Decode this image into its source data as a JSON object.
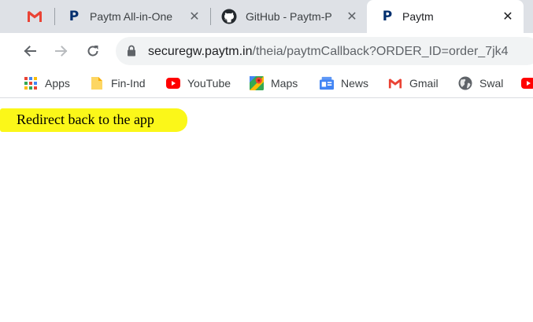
{
  "tabs": [
    {
      "title": "",
      "icon": "gmail-icon",
      "active": false
    },
    {
      "title": "Paytm All-in-One",
      "icon": "paytm-icon",
      "active": false
    },
    {
      "title": "GitHub - Paytm-P",
      "icon": "github-icon",
      "active": false
    },
    {
      "title": "Paytm",
      "icon": "paytm-icon",
      "active": true
    }
  ],
  "tab_close_glyph": "✕",
  "omnibox": {
    "host": "securegw.paytm.in",
    "path": "/theia/paytmCallback?ORDER_ID=order_7jk4"
  },
  "bookmarks": [
    {
      "label": "Apps",
      "icon": "apps-grid-icon"
    },
    {
      "label": "Fin-Ind",
      "icon": "folder-icon"
    },
    {
      "label": "YouTube",
      "icon": "youtube-icon"
    },
    {
      "label": "Maps",
      "icon": "maps-icon"
    },
    {
      "label": "News",
      "icon": "google-news-icon"
    },
    {
      "label": "Gmail",
      "icon": "gmail-icon"
    },
    {
      "label": "Swal",
      "icon": "globe-icon"
    }
  ],
  "content": {
    "redirect_text": "Redirect back to the app"
  },
  "colors": {
    "highlight": "#fbf719",
    "tabstrip": "#dee1e6",
    "omnibox": "#f1f3f4",
    "paytm_blue": "#002e6e",
    "youtube_red": "#ff0000",
    "gmail_red": "#ea4335"
  }
}
